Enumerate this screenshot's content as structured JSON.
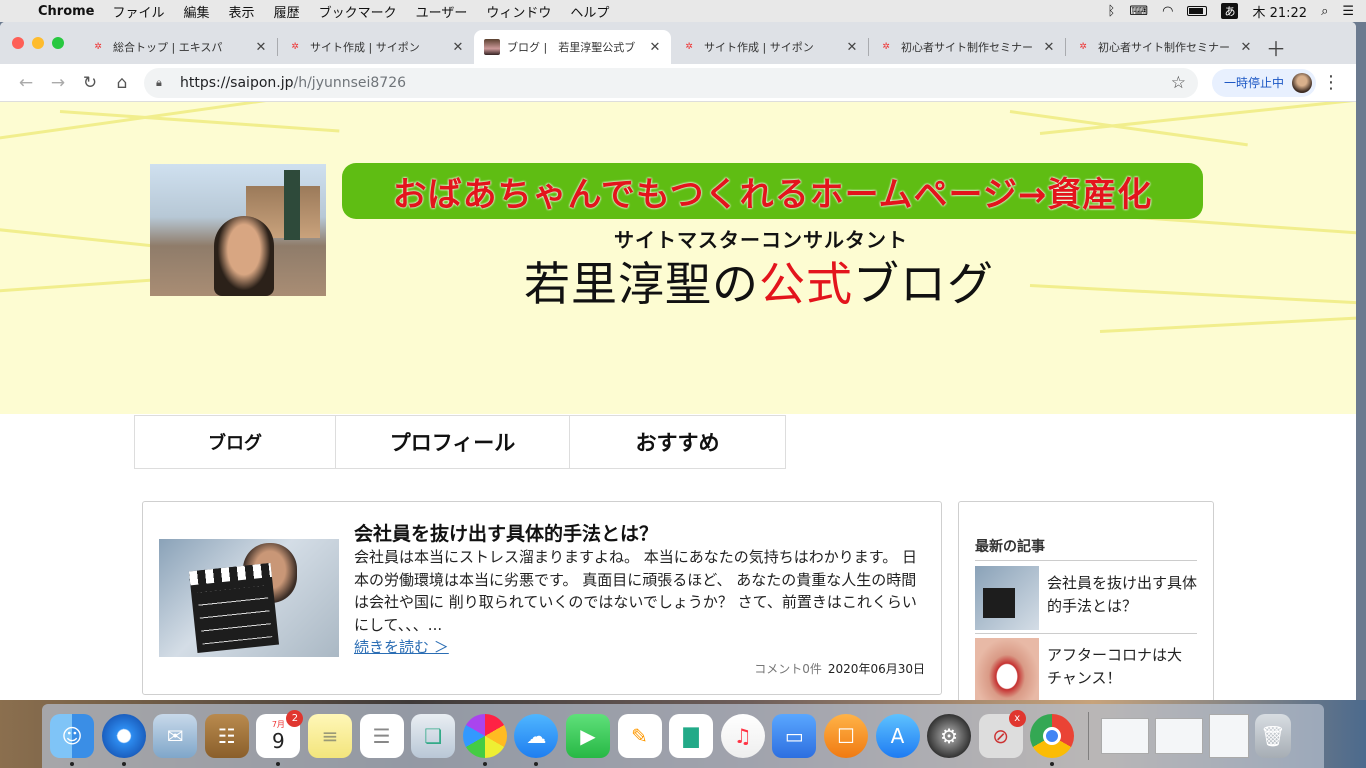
{
  "menubar": {
    "app_name": "Chrome",
    "menus": [
      "ファイル",
      "編集",
      "表示",
      "履歴",
      "ブックマーク",
      "ユーザー",
      "ウィンドウ",
      "ヘルプ"
    ],
    "ime": "あ",
    "clock": "木 21:22"
  },
  "tabs": [
    {
      "title": "総合トップ | エキスパ",
      "icon": "ekispa-favicon",
      "active": false
    },
    {
      "title": "サイト作成 | サイポン",
      "icon": "saipon-favicon",
      "active": false
    },
    {
      "title": "ブログ |　若里淳聖公式ブ",
      "icon": "author-photo-favicon",
      "active": true
    },
    {
      "title": "サイト作成 | サイポン",
      "icon": "saipon-favicon",
      "active": false
    },
    {
      "title": "初心者サイト制作セミナー",
      "icon": "saipon-favicon",
      "active": false
    },
    {
      "title": "初心者サイト制作セミナー",
      "icon": "saipon-favicon",
      "active": false
    }
  ],
  "toolbar": {
    "url_host": "https://saipon.jp",
    "url_path": "/h/jyunnsei8726",
    "paused_label": "一時停止中"
  },
  "hero": {
    "banner_text": "おばあちゃんでもつくれるホームページ→資産化",
    "subtitle": "サイトマスターコンサルタント",
    "title_prefix": "若里淳聖の",
    "title_accent": "公式",
    "title_suffix": "ブログ",
    "accent_color": "#e3141c",
    "banner_color": "#5fbd13"
  },
  "nav": {
    "items": [
      "ブログ",
      "プロフィール",
      "おすすめ"
    ]
  },
  "post": {
    "title": "会社員を抜け出す具体的手法とは？",
    "excerpt": "会社員は本当にストレス溜まりますよね。 本当にあなたの気持ちはわかります。 日本の労働環境は本当に劣悪です。 真面目に頑張るほど、 あなたの貴重な人生の時間は会社や国に 削り取られていくのではないでしょうか？ さて、前置きはこれくらいにして、、、...",
    "read_more": "続きを読む ＞",
    "comments": "コメント0件",
    "date": "2020年06月30日"
  },
  "sidebar": {
    "heading": "最新の記事",
    "items": [
      {
        "title": "会社員を抜け出す具体的手法とは？"
      },
      {
        "title": "アフターコロナは大チャンス！"
      }
    ]
  },
  "dock": {
    "calendar_month": "7月",
    "calendar_day": "9",
    "calendar_badge": "2",
    "app_badge": "x"
  }
}
